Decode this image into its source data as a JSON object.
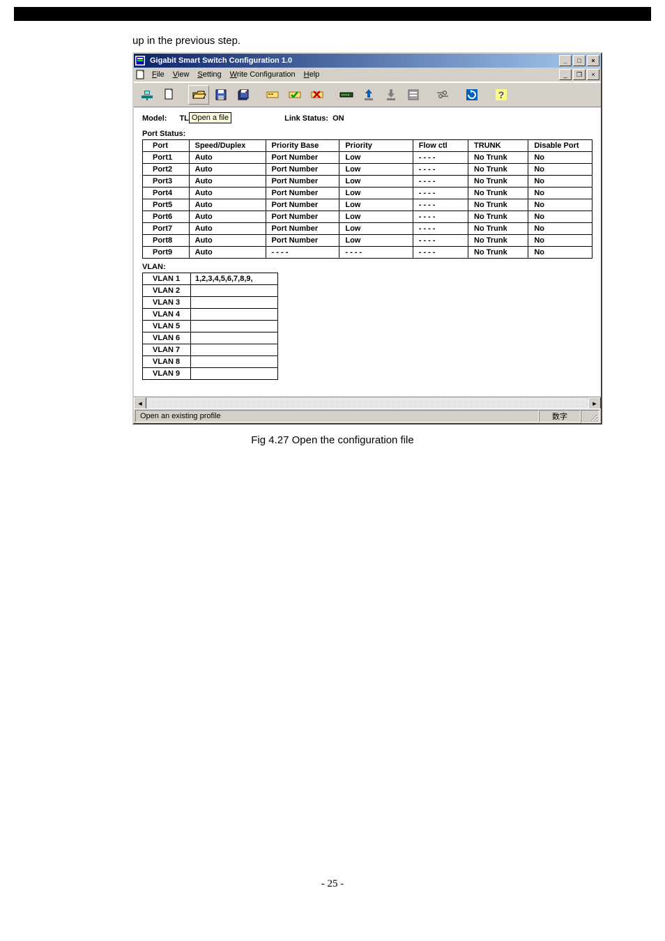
{
  "intro": "up in the previous step.",
  "window": {
    "title": "Gigabit Smart Switch Configuration 1.0",
    "menu": [
      "File",
      "View",
      "Setting",
      "Write Configuration",
      "Help"
    ],
    "tooltip": "Open a file",
    "model_label": "Model:",
    "model_value": "TL",
    "link_status_label": "Link Status:",
    "link_status_value": "ON",
    "port_status_label": "Port Status:",
    "port_headers": [
      "Port",
      "Speed/Duplex",
      "Priority Base",
      "Priority",
      "Flow ctl",
      "TRUNK",
      "Disable Port"
    ],
    "ports": [
      {
        "p": "Port1",
        "sd": "Auto",
        "pb": "Port Number",
        "pr": "Low",
        "fc": "- - - -",
        "tr": "No Trunk",
        "dp": "No"
      },
      {
        "p": "Port2",
        "sd": "Auto",
        "pb": "Port Number",
        "pr": "Low",
        "fc": "- - - -",
        "tr": "No Trunk",
        "dp": "No"
      },
      {
        "p": "Port3",
        "sd": "Auto",
        "pb": "Port Number",
        "pr": "Low",
        "fc": "- - - -",
        "tr": "No Trunk",
        "dp": "No"
      },
      {
        "p": "Port4",
        "sd": "Auto",
        "pb": "Port Number",
        "pr": "Low",
        "fc": "- - - -",
        "tr": "No Trunk",
        "dp": "No"
      },
      {
        "p": "Port5",
        "sd": "Auto",
        "pb": "Port Number",
        "pr": "Low",
        "fc": "- - - -",
        "tr": "No Trunk",
        "dp": "No"
      },
      {
        "p": "Port6",
        "sd": "Auto",
        "pb": "Port Number",
        "pr": "Low",
        "fc": "- - - -",
        "tr": "No Trunk",
        "dp": "No"
      },
      {
        "p": "Port7",
        "sd": "Auto",
        "pb": "Port Number",
        "pr": "Low",
        "fc": "- - - -",
        "tr": "No Trunk",
        "dp": "No"
      },
      {
        "p": "Port8",
        "sd": "Auto",
        "pb": "Port Number",
        "pr": "Low",
        "fc": "- - - -",
        "tr": "No Trunk",
        "dp": "No"
      },
      {
        "p": "Port9",
        "sd": "Auto",
        "pb": "- - - -",
        "pr": "- - - -",
        "fc": "- - - -",
        "tr": "No Trunk",
        "dp": "No"
      }
    ],
    "vlan_label": "VLAN:",
    "vlans": [
      {
        "name": "VLAN 1",
        "ports": "1,2,3,4,5,6,7,8,9,"
      },
      {
        "name": "VLAN 2",
        "ports": ""
      },
      {
        "name": "VLAN 3",
        "ports": ""
      },
      {
        "name": "VLAN 4",
        "ports": ""
      },
      {
        "name": "VLAN 5",
        "ports": ""
      },
      {
        "name": "VLAN 6",
        "ports": ""
      },
      {
        "name": "VLAN 7",
        "ports": ""
      },
      {
        "name": "VLAN 8",
        "ports": ""
      },
      {
        "name": "VLAN 9",
        "ports": ""
      }
    ],
    "status_text": "Open an existing profile",
    "status_right": "数字"
  },
  "caption": "Fig 4.27 Open the configuration file",
  "footer": "- 25 -"
}
